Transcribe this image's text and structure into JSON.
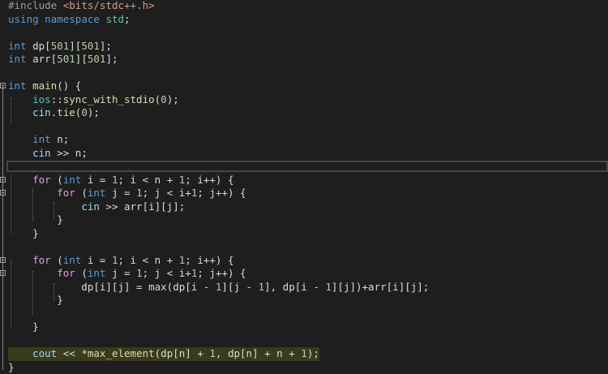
{
  "code_lines": [
    "#include <bits/stdc++.h>",
    "using namespace std;",
    "",
    "int dp[501][501];",
    "int arr[501][501];",
    "",
    "int main() {",
    "    ios::sync_with_stdio(0);",
    "    cin.tie(0);",
    "",
    "    int n;",
    "    cin >> n;",
    "",
    "    for (int i = 1; i < n + 1; i++) {",
    "        for (int j = 1; j < i+1; j++) {",
    "            cin >> arr[i][j];",
    "        }",
    "    }",
    "",
    "    for (int i = 1; i < n + 1; i++) {",
    "        for (int j = 1; j < i+1; j++) {",
    "            dp[i][j] = max(dp[i - 1][j - 1], dp[i - 1][j])+arr[i][j];",
    "        }",
    "",
    "    }",
    "",
    "    cout << *max_element(dp[n] + 1, dp[n] + n + 1);",
    "}"
  ],
  "editor": {
    "current_line": 12,
    "highlighted_line": 26,
    "fold_markers_at_lines": [
      6,
      13,
      14,
      19,
      20
    ]
  }
}
